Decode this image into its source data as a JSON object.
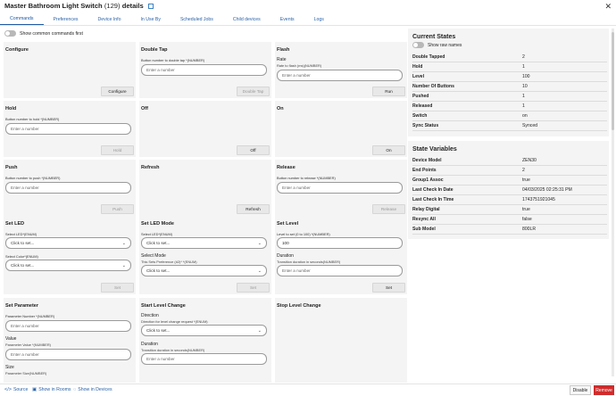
{
  "window": {
    "title_name": "Master Bathroom Light Switch",
    "title_count": "(129)",
    "title_suffix": "details"
  },
  "tabs": [
    "Commands",
    "Preferences",
    "Device Info",
    "In Use By",
    "Scheduled Jobs",
    "Child devices",
    "Events",
    "Logs"
  ],
  "show_common_label": "Show common commands first",
  "placeholders": {
    "number": "Enter a number",
    "select": "Click to set..."
  },
  "commands": {
    "configure": {
      "title": "Configure",
      "button": "Configure"
    },
    "double_tap": {
      "title": "Double Tap",
      "field": "Button number to double tap *(NUMBER)",
      "button": "Double Tap"
    },
    "flash": {
      "title": "Flash",
      "field_title": "Rate",
      "field": "Rate to flash (ms)(NUMBER)",
      "button": "Run"
    },
    "hold": {
      "title": "Hold",
      "field": "Button number to hold *(NUMBER)",
      "button": "Hold"
    },
    "off": {
      "title": "Off",
      "button": "Off"
    },
    "on": {
      "title": "On",
      "button": "On"
    },
    "push": {
      "title": "Push",
      "field": "Button number to push *(NUMBER)",
      "button": "Push"
    },
    "refresh": {
      "title": "Refresh",
      "button": "Refresh"
    },
    "release": {
      "title": "Release",
      "field": "Button number to release *(NUMBER)",
      "button": "Release"
    },
    "set_led": {
      "title": "Set LED",
      "field1": "Select LED*(ENUM)",
      "field2": "Select Color*(ENUM)",
      "button": "Set"
    },
    "set_led_mode": {
      "title": "Set LED Mode",
      "field1": "Select LED*(ENUM)",
      "field2_title": "Select Mode",
      "field2": "This Sets Preference (#2)* *(ENUM)",
      "button": "Set"
    },
    "set_level": {
      "title": "Set Level",
      "field1": "Level to set (0 to 100) *(NUMBER)",
      "value": "100",
      "field2_title": "Duration",
      "field2": "Transition duration in seconds(NUMBER)",
      "button": "Set"
    },
    "set_parameter": {
      "title": "Set Parameter",
      "field1": "Parameter Number *(NUMBER)",
      "field2_title": "Value",
      "field2": "Parameter Value *(NUMBER)",
      "field3_title": "Size",
      "field3": "Parameter Size(NUMBER)"
    },
    "start_level_change": {
      "title": "Start Level Change",
      "field1_title": "Direction",
      "field1": "Direction for level change request *(ENUM)",
      "field2_title": "Duration",
      "field2": "Transition duration in seconds(NUMBER)"
    },
    "stop_level_change": {
      "title": "Stop Level Change"
    }
  },
  "current_states": {
    "title": "Current States",
    "raw_names_label": "Show raw names",
    "rows": [
      {
        "k": "Double Tapped",
        "v": "2"
      },
      {
        "k": "Hold",
        "v": "1"
      },
      {
        "k": "Level",
        "v": "100"
      },
      {
        "k": "Number Of Buttons",
        "v": "10"
      },
      {
        "k": "Pushed",
        "v": "1"
      },
      {
        "k": "Released",
        "v": "1"
      },
      {
        "k": "Switch",
        "v": "on"
      },
      {
        "k": "Sync Status",
        "v": "Synced"
      }
    ]
  },
  "state_variables": {
    "title": "State Variables",
    "rows": [
      {
        "k": "Device Model",
        "v": "ZEN30"
      },
      {
        "k": "End Points",
        "v": "2"
      },
      {
        "k": "Group1 Assoc",
        "v": "true"
      },
      {
        "k": "Last Check In Date",
        "v": "04/03/2025 02:25:31 PM"
      },
      {
        "k": "Last Check In Time",
        "v": "1743751921045"
      },
      {
        "k": "Relay Digital",
        "v": "true"
      },
      {
        "k": "Resync All",
        "v": "false"
      },
      {
        "k": "Sub Model",
        "v": "800LR"
      }
    ]
  },
  "footer": {
    "source": "Source",
    "show_in_rooms": "Show in Rooms",
    "show_in_devices": "Show in Devices",
    "disable": "Disable",
    "remove": "Remove"
  },
  "colors": {
    "accent": "#2b63a7",
    "remove": "#d12b2b",
    "card_bg": "#f4f4f4"
  }
}
